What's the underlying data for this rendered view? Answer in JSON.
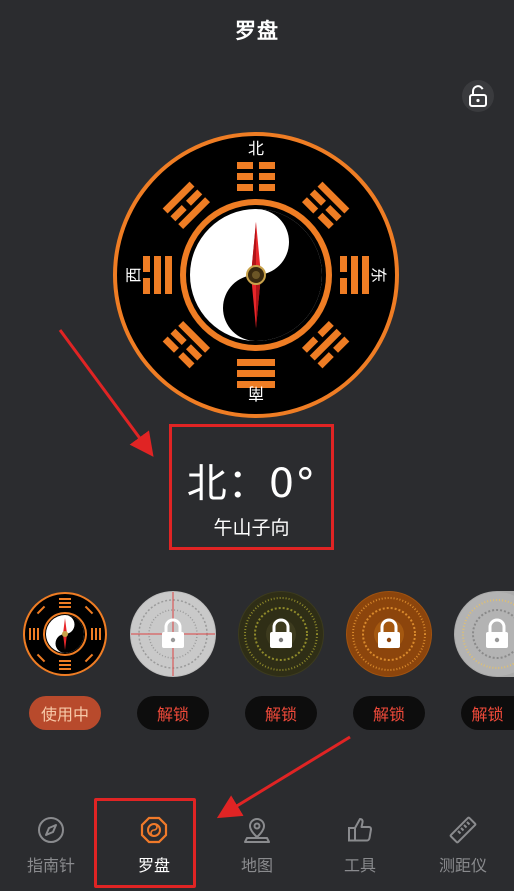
{
  "header": {
    "title": "罗盘"
  },
  "compass": {
    "labels": {
      "north": "北",
      "east": "东",
      "south": "南",
      "west": "西"
    },
    "heading_degrees": 0
  },
  "readout": {
    "direction": "北：0°",
    "mountain": "午山子向"
  },
  "skins": [
    {
      "name": "bagua-black-orange",
      "button": "使用中",
      "state": "in-use"
    },
    {
      "name": "silver-grid",
      "button": "解锁",
      "state": "locked"
    },
    {
      "name": "dark-olive",
      "button": "解锁",
      "state": "locked"
    },
    {
      "name": "amber-brown",
      "button": "解锁",
      "state": "locked"
    },
    {
      "name": "silver-engraved",
      "button": "解锁",
      "state": "locked"
    }
  ],
  "tabbar": {
    "items": [
      {
        "label": "指南针",
        "icon": "compass-icon"
      },
      {
        "label": "罗盘",
        "icon": "luopan-icon",
        "active": true
      },
      {
        "label": "地图",
        "icon": "map-pin-icon"
      },
      {
        "label": "工具",
        "icon": "thumbs-up-icon"
      },
      {
        "label": "测距仪",
        "icon": "ruler-icon"
      }
    ]
  },
  "colors": {
    "background": "#2b2c2f",
    "accent_orange": "#ef7d24",
    "highlight_red": "#e02424",
    "unlock_text": "#f04a3a"
  }
}
